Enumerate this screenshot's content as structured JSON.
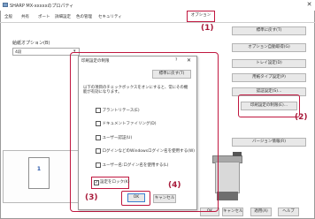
{
  "window": {
    "title": "SHARP MX-xxxxxのプロパティ",
    "close_glyph": "✕"
  },
  "tabs": [
    {
      "label": "全般"
    },
    {
      "label": "共有"
    },
    {
      "label": "ポート"
    },
    {
      "label": "詳細設定"
    },
    {
      "label": "色の管理"
    },
    {
      "label": "セキュリティ"
    },
    {
      "label": "オプション"
    }
  ],
  "left_panel": {
    "label": "給紙オプション(B)",
    "select_value": "4段",
    "select_caret": "▾"
  },
  "right_buttons": {
    "restore_default": "標準に戻す(T)",
    "option_device": "オプション自動取得(G)",
    "tray": "トレイ設定(D)",
    "paper_type": "用紙タイプ設定(P)",
    "auth": "認証設定(S)...",
    "restrict": "印刷設定の制限(E)...",
    "version": "バージョン情報(R)"
  },
  "preview": {
    "page_number": "1"
  },
  "bottom_buttons": {
    "ok": "OK",
    "cancel": "キャンセル",
    "apply": "適用(A)",
    "help": "ヘルプ"
  },
  "dialog": {
    "title": "印刷設定の制限",
    "help_glyph": "?",
    "close_glyph": "✕",
    "restore_label": "標準に戻す(T)",
    "description": "以下の項目のチェックボックスをオンにすると、常にその機能が有効になります。",
    "checkboxes": [
      "ブラントリテース(E)",
      "ドキュメントファイリング(D)",
      "ユーザー認証(U)",
      "ログインなどのWindowsログイン名を使用する(W)",
      "ユーザー名:ログイン名を使用する(L)"
    ],
    "lock_checkbox": {
      "label": "設定をロック(K)",
      "checked_glyph": "✓"
    },
    "ok_label": "OK",
    "cancel_label": "キャンセル"
  },
  "callouts": {
    "c1": "(1)",
    "c2": "(2)",
    "c3": "(3)",
    "c4": "(4)"
  },
  "colors": {
    "highlight": "#c0173f",
    "callout_text": "#a81a3a"
  },
  "icons": [
    "app-icon",
    "printer-illustration",
    "close-icon",
    "help-icon"
  ]
}
